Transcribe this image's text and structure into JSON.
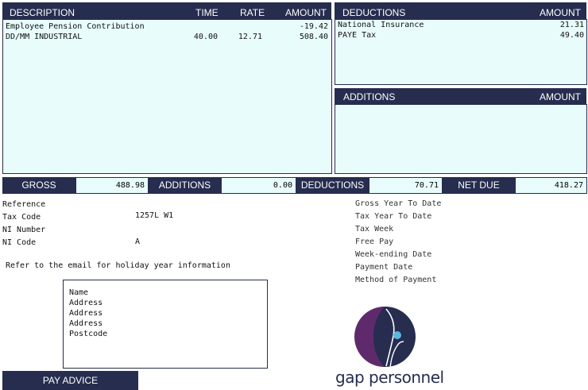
{
  "earnings": {
    "headers": {
      "description": "DESCRIPTION",
      "time": "TIME",
      "rate": "RATE",
      "amount": "AMOUNT"
    },
    "rows": [
      {
        "description": "Employee Pension Contribution",
        "time": "",
        "rate": "",
        "amount": "-19.42"
      },
      {
        "description": "DD/MM INDUSTRIAL",
        "time": "40.00",
        "rate": "12.71",
        "amount": "508.40"
      }
    ]
  },
  "deductions": {
    "headers": {
      "title": "DEDUCTIONS",
      "amount": "AMOUNT"
    },
    "rows": [
      {
        "label": "National Insurance",
        "amount": "21.31"
      },
      {
        "label": "PAYE Tax",
        "amount": "49.40"
      }
    ]
  },
  "additions": {
    "headers": {
      "title": "ADDITIONS",
      "amount": "AMOUNT"
    }
  },
  "totals": {
    "gross_label": "GROSS",
    "gross_value": "488.98",
    "additions_label": "ADDITIONS",
    "additions_value": "0.00",
    "deductions_label": "DEDUCTIONS",
    "deductions_value": "70.71",
    "net_label": "NET DUE",
    "net_value": "418.27"
  },
  "employee": {
    "reference_label": "Reference",
    "tax_code_label": "Tax Code",
    "tax_code_value": "1257L W1",
    "ni_number_label": "NI Number",
    "ni_code_label": "NI Code",
    "ni_code_value": "A"
  },
  "pay_info": {
    "labels": [
      "Gross Year To Date",
      "Tax Year To Date",
      "Tax Week",
      "Free Pay",
      "Week-ending Date",
      "Payment Date",
      "Method of Payment"
    ]
  },
  "note": "Refer to the email for holiday year information",
  "address": [
    "Name",
    "Address",
    "Address",
    "Address",
    "Postcode"
  ],
  "footer": {
    "pay_advice": "PAY ADVICE"
  },
  "logo": {
    "text": "gap personnel",
    "colors": {
      "purple": "#5e2a6b",
      "navy": "#262d4f",
      "dot": "#5ab7e0"
    }
  },
  "colors": {
    "header_bg": "#262d4f",
    "panel_bg": "#e8fdfb"
  }
}
